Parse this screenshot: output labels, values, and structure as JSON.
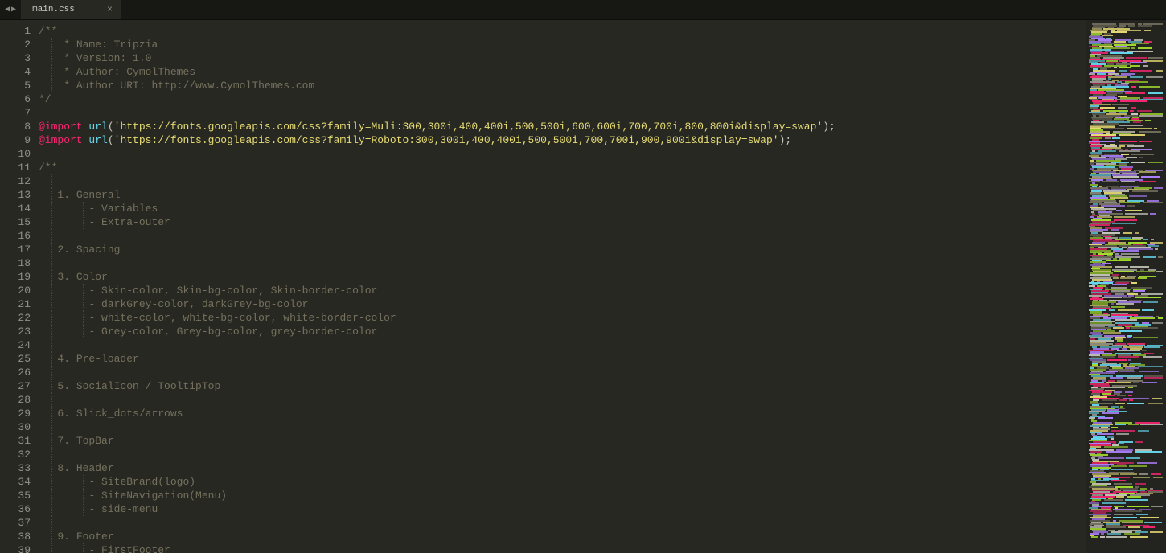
{
  "tabs": {
    "active": {
      "title": "main.css"
    }
  },
  "nav": {
    "back": "◀",
    "forward": "▶"
  },
  "code": {
    "lines": [
      {
        "n": 1,
        "t": "cmt",
        "txt": "/**"
      },
      {
        "n": 2,
        "t": "cmt",
        "txt": " * Name: Tripzia",
        "indent": 1
      },
      {
        "n": 3,
        "t": "cmt",
        "txt": " * Version: 1.0",
        "indent": 1
      },
      {
        "n": 4,
        "t": "cmt",
        "txt": " * Author: CymolThemes",
        "indent": 1
      },
      {
        "n": 5,
        "t": "cmt",
        "txt": " * Author URI: http://www.CymolThemes.com",
        "indent": 1
      },
      {
        "n": 6,
        "t": "cmt",
        "txt": "*/"
      },
      {
        "n": 7,
        "t": "blank",
        "txt": ""
      },
      {
        "n": 8,
        "t": "import",
        "kw": "@import",
        "fn": "url",
        "open": "(",
        "str": "'https://fonts.googleapis.com/css?family=Muli:300,300i,400,400i,500,500i,600,600i,700,700i,800,800i&display=swap'",
        "close": ");"
      },
      {
        "n": 9,
        "t": "import",
        "kw": "@import",
        "fn": "url",
        "open": "(",
        "str": "'https://fonts.googleapis.com/css?family=Roboto:300,300i,400,400i,500,500i,700,700i,900,900i&display=swap'",
        "close": ");"
      },
      {
        "n": 10,
        "t": "blank",
        "txt": ""
      },
      {
        "n": 11,
        "t": "cmt",
        "txt": "/**"
      },
      {
        "n": 12,
        "t": "blank-guided",
        "indent": 1
      },
      {
        "n": 13,
        "t": "cmt",
        "txt": "1. General",
        "indent": 1
      },
      {
        "n": 14,
        "t": "cmt",
        "txt": "- Variables",
        "indent": 2
      },
      {
        "n": 15,
        "t": "cmt",
        "txt": "- Extra-outer",
        "indent": 2
      },
      {
        "n": 16,
        "t": "blank-guided",
        "indent": 1
      },
      {
        "n": 17,
        "t": "cmt",
        "txt": "2. Spacing",
        "indent": 1
      },
      {
        "n": 18,
        "t": "blank-guided",
        "indent": 1
      },
      {
        "n": 19,
        "t": "cmt",
        "txt": "3. Color",
        "indent": 1
      },
      {
        "n": 20,
        "t": "cmt",
        "txt": "- Skin-color, Skin-bg-color, Skin-border-color",
        "indent": 2
      },
      {
        "n": 21,
        "t": "cmt",
        "txt": "- darkGrey-color, darkGrey-bg-color",
        "indent": 2
      },
      {
        "n": 22,
        "t": "cmt",
        "txt": "- white-color, white-bg-color, white-border-color",
        "indent": 2
      },
      {
        "n": 23,
        "t": "cmt",
        "txt": "- Grey-color, Grey-bg-color, grey-border-color",
        "indent": 2
      },
      {
        "n": 24,
        "t": "blank-guided",
        "indent": 1
      },
      {
        "n": 25,
        "t": "cmt",
        "txt": "4. Pre-loader",
        "indent": 1
      },
      {
        "n": 26,
        "t": "blank-guided",
        "indent": 1
      },
      {
        "n": 27,
        "t": "cmt",
        "txt": "5. SocialIcon / TooltipTop",
        "indent": 1
      },
      {
        "n": 28,
        "t": "blank-guided",
        "indent": 1
      },
      {
        "n": 29,
        "t": "cmt",
        "txt": "6. Slick_dots/arrows",
        "indent": 1
      },
      {
        "n": 30,
        "t": "blank-guided",
        "indent": 1
      },
      {
        "n": 31,
        "t": "cmt",
        "txt": "7. TopBar",
        "indent": 1
      },
      {
        "n": 32,
        "t": "blank-guided",
        "indent": 1
      },
      {
        "n": 33,
        "t": "cmt",
        "txt": "8. Header",
        "indent": 1
      },
      {
        "n": 34,
        "t": "cmt",
        "txt": "- SiteBrand(logo)",
        "indent": 2
      },
      {
        "n": 35,
        "t": "cmt",
        "txt": "- SiteNavigation(Menu)",
        "indent": 2
      },
      {
        "n": 36,
        "t": "cmt",
        "txt": "- side-menu",
        "indent": 2
      },
      {
        "n": 37,
        "t": "blank-guided",
        "indent": 1
      },
      {
        "n": 38,
        "t": "cmt",
        "txt": "9. Footer",
        "indent": 1
      },
      {
        "n": 39,
        "t": "cmt",
        "txt": "- FirstFooter",
        "indent": 2
      }
    ]
  }
}
